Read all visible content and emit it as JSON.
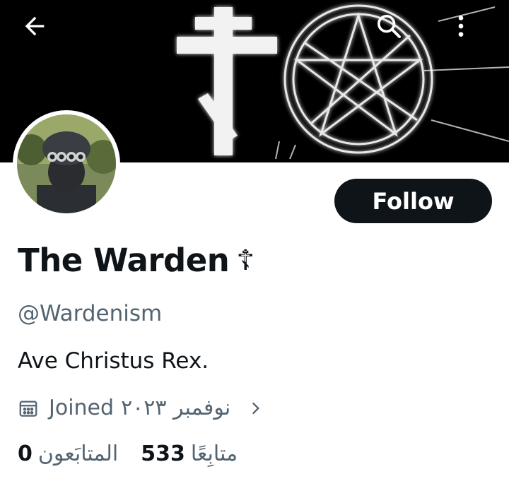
{
  "profile": {
    "display_name": "The Warden",
    "name_emoji": "☦",
    "handle": "@Wardenism",
    "bio": "Ave Christus Rex.",
    "joined_label": "Joined",
    "joined_date": "نوفمبر ٢٠٢٣",
    "follow_label": "Follow"
  },
  "stats": {
    "following_count": "533",
    "following_label": "متابِعًا",
    "followers_count": "0",
    "followers_label": "المتابَعون"
  },
  "icons": {
    "back": "arrow-left-icon",
    "search": "search-icon",
    "more": "more-vertical-icon",
    "calendar": "calendar-icon",
    "chevron": "chevron-right-icon"
  },
  "colors": {
    "text": "#0f1419",
    "secondary": "#536471",
    "follow_bg": "#0f1419",
    "follow_text": "#ffffff",
    "banner_bg": "#000000"
  }
}
